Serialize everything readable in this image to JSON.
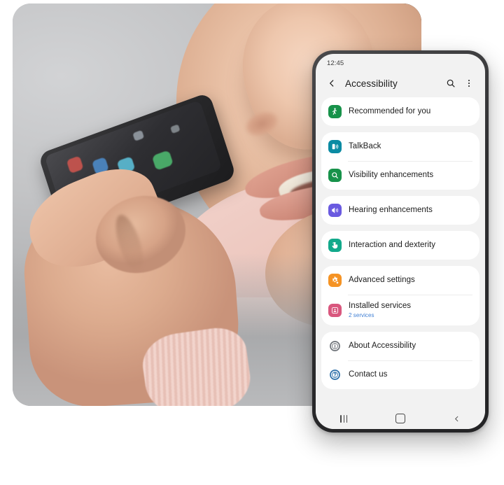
{
  "photo": {
    "alt_description": "Woman holding a smartphone near her mouth speaking to it",
    "background_color": "#b4b5b7",
    "sweater_color": "#ecc6bd"
  },
  "phone": {
    "status_bar": {
      "time": "12:45"
    },
    "app_bar": {
      "back_icon": "back-arrow-icon",
      "title": "Accessibility",
      "search_icon": "search-icon",
      "more_icon": "more-vertical-icon"
    },
    "groups": [
      {
        "items": [
          {
            "label": "Recommended for you",
            "sub": "",
            "icon": "accessibility-person-icon",
            "color": "#17924a"
          }
        ]
      },
      {
        "items": [
          {
            "label": "TalkBack",
            "sub": "",
            "icon": "talkback-speaker-icon",
            "color": "#0b8ba3"
          },
          {
            "label": "Visibility enhancements",
            "sub": "",
            "icon": "magnifier-icon",
            "color": "#17924a"
          }
        ]
      },
      {
        "items": [
          {
            "label": "Hearing enhancements",
            "sub": "",
            "icon": "volume-speaker-icon",
            "color": "#6a5ae0"
          }
        ]
      },
      {
        "items": [
          {
            "label": "Interaction and dexterity",
            "sub": "",
            "icon": "hand-touch-icon",
            "color": "#12a98b"
          }
        ]
      },
      {
        "items": [
          {
            "label": "Advanced settings",
            "sub": "",
            "icon": "gear-icon",
            "color": "#f59324"
          },
          {
            "label": "Installed services",
            "sub": "2 services",
            "icon": "installed-services-icon",
            "color": "#d9577e"
          }
        ]
      },
      {
        "items": [
          {
            "label": "About Accessibility",
            "sub": "",
            "icon": "info-circle-icon",
            "color": "#6d7278"
          },
          {
            "label": "Contact us",
            "sub": "",
            "icon": "question-circle-icon",
            "color": "#2a6ea8"
          }
        ]
      }
    ],
    "nav_bar": {
      "recents_icon": "recents-icon",
      "home_icon": "home-icon",
      "back_icon": "nav-back-icon"
    }
  }
}
